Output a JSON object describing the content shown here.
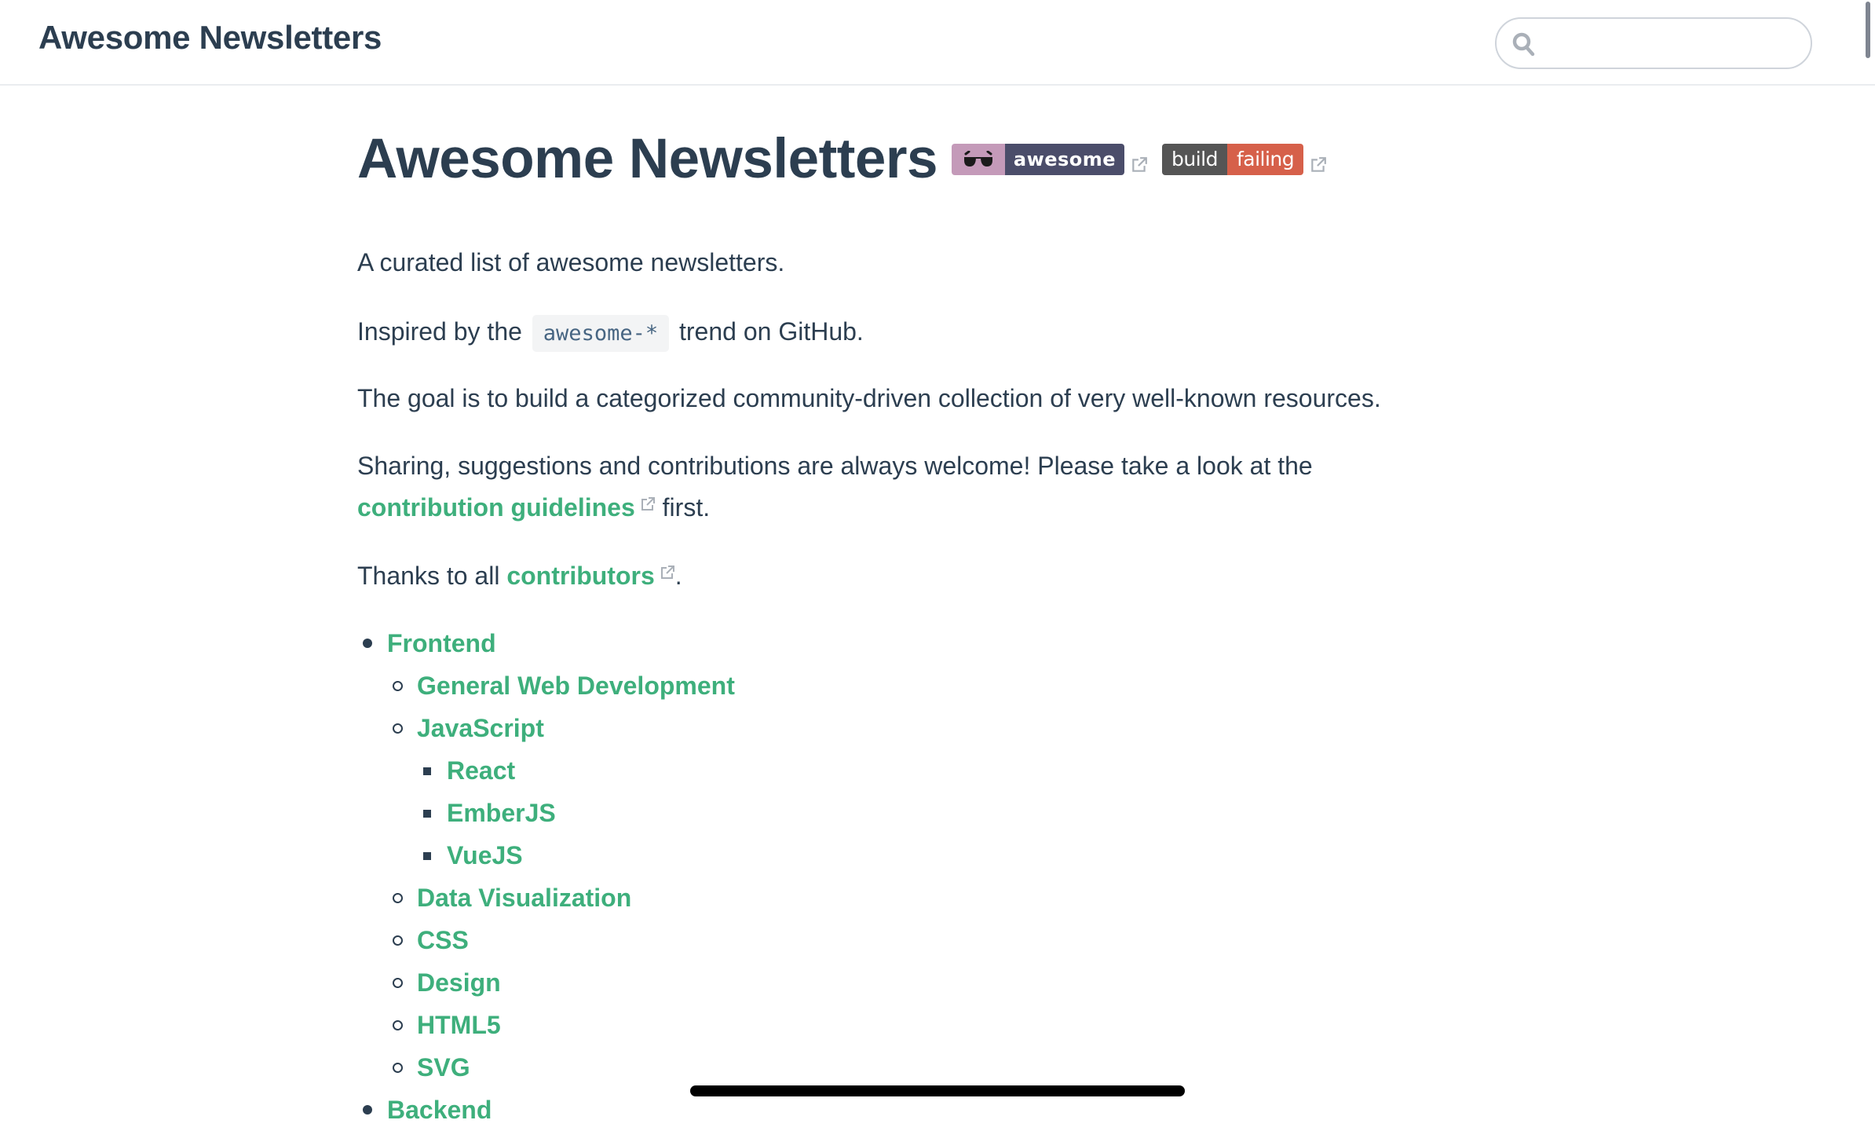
{
  "navbar": {
    "site_name": "Awesome Newsletters",
    "search": {
      "value": "",
      "placeholder": ""
    }
  },
  "page": {
    "title": "Awesome Newsletters",
    "badges": [
      {
        "icon": "sunglasses-icon",
        "label": "awesome",
        "left_color": "#c49ab9",
        "right_color": "#4b4d6a"
      },
      {
        "label_left": "build",
        "label_right": "failing",
        "left_color": "#555555",
        "right_color": "#d6604a"
      }
    ],
    "intro": "A curated list of awesome newsletters.",
    "inspired": {
      "before": "Inspired by the",
      "code": "awesome-*",
      "after": "trend on GitHub."
    },
    "goal": "The goal is to build a categorized community-driven collection of very well-known resources.",
    "sharing": {
      "line1": "Sharing, suggestions and contributions are always welcome! Please take a look at the",
      "link": "contribution guidelines",
      "after": "first."
    },
    "thanks": {
      "before": "Thanks to all",
      "link": "contributors",
      "after": "."
    }
  },
  "toc": [
    {
      "label": "Frontend",
      "children": [
        {
          "label": "General Web Development"
        },
        {
          "label": "JavaScript",
          "children": [
            {
              "label": "React"
            },
            {
              "label": "EmberJS"
            },
            {
              "label": "VueJS"
            }
          ]
        },
        {
          "label": "Data Visualization"
        },
        {
          "label": "CSS"
        },
        {
          "label": "Design"
        },
        {
          "label": "HTML5"
        },
        {
          "label": "SVG"
        }
      ]
    },
    {
      "label": "Backend"
    }
  ],
  "colors": {
    "text": "#2c3e50",
    "link": "#3eaf7c",
    "code_bg": "#f3f4f5",
    "code_text": "#476582"
  }
}
